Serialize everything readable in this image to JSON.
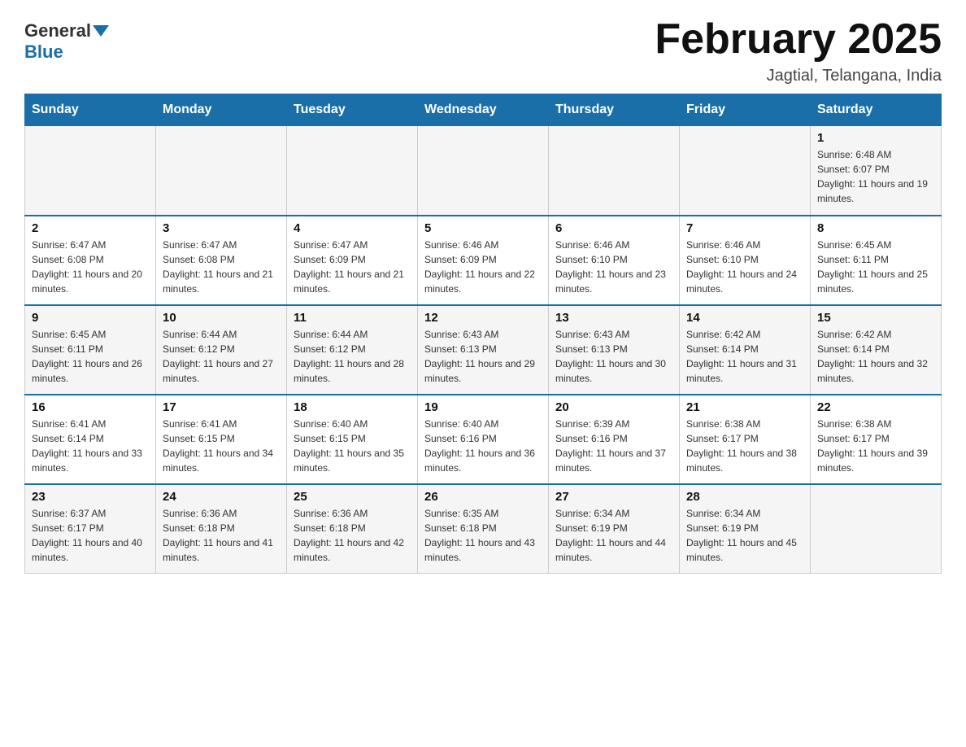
{
  "header": {
    "logo_general": "General",
    "logo_blue": "Blue",
    "title": "February 2025",
    "location": "Jagtial, Telangana, India"
  },
  "days_of_week": [
    "Sunday",
    "Monday",
    "Tuesday",
    "Wednesday",
    "Thursday",
    "Friday",
    "Saturday"
  ],
  "weeks": [
    [
      {
        "day": "",
        "info": ""
      },
      {
        "day": "",
        "info": ""
      },
      {
        "day": "",
        "info": ""
      },
      {
        "day": "",
        "info": ""
      },
      {
        "day": "",
        "info": ""
      },
      {
        "day": "",
        "info": ""
      },
      {
        "day": "1",
        "info": "Sunrise: 6:48 AM\nSunset: 6:07 PM\nDaylight: 11 hours and 19 minutes."
      }
    ],
    [
      {
        "day": "2",
        "info": "Sunrise: 6:47 AM\nSunset: 6:08 PM\nDaylight: 11 hours and 20 minutes."
      },
      {
        "day": "3",
        "info": "Sunrise: 6:47 AM\nSunset: 6:08 PM\nDaylight: 11 hours and 21 minutes."
      },
      {
        "day": "4",
        "info": "Sunrise: 6:47 AM\nSunset: 6:09 PM\nDaylight: 11 hours and 21 minutes."
      },
      {
        "day": "5",
        "info": "Sunrise: 6:46 AM\nSunset: 6:09 PM\nDaylight: 11 hours and 22 minutes."
      },
      {
        "day": "6",
        "info": "Sunrise: 6:46 AM\nSunset: 6:10 PM\nDaylight: 11 hours and 23 minutes."
      },
      {
        "day": "7",
        "info": "Sunrise: 6:46 AM\nSunset: 6:10 PM\nDaylight: 11 hours and 24 minutes."
      },
      {
        "day": "8",
        "info": "Sunrise: 6:45 AM\nSunset: 6:11 PM\nDaylight: 11 hours and 25 minutes."
      }
    ],
    [
      {
        "day": "9",
        "info": "Sunrise: 6:45 AM\nSunset: 6:11 PM\nDaylight: 11 hours and 26 minutes."
      },
      {
        "day": "10",
        "info": "Sunrise: 6:44 AM\nSunset: 6:12 PM\nDaylight: 11 hours and 27 minutes."
      },
      {
        "day": "11",
        "info": "Sunrise: 6:44 AM\nSunset: 6:12 PM\nDaylight: 11 hours and 28 minutes."
      },
      {
        "day": "12",
        "info": "Sunrise: 6:43 AM\nSunset: 6:13 PM\nDaylight: 11 hours and 29 minutes."
      },
      {
        "day": "13",
        "info": "Sunrise: 6:43 AM\nSunset: 6:13 PM\nDaylight: 11 hours and 30 minutes."
      },
      {
        "day": "14",
        "info": "Sunrise: 6:42 AM\nSunset: 6:14 PM\nDaylight: 11 hours and 31 minutes."
      },
      {
        "day": "15",
        "info": "Sunrise: 6:42 AM\nSunset: 6:14 PM\nDaylight: 11 hours and 32 minutes."
      }
    ],
    [
      {
        "day": "16",
        "info": "Sunrise: 6:41 AM\nSunset: 6:14 PM\nDaylight: 11 hours and 33 minutes."
      },
      {
        "day": "17",
        "info": "Sunrise: 6:41 AM\nSunset: 6:15 PM\nDaylight: 11 hours and 34 minutes."
      },
      {
        "day": "18",
        "info": "Sunrise: 6:40 AM\nSunset: 6:15 PM\nDaylight: 11 hours and 35 minutes."
      },
      {
        "day": "19",
        "info": "Sunrise: 6:40 AM\nSunset: 6:16 PM\nDaylight: 11 hours and 36 minutes."
      },
      {
        "day": "20",
        "info": "Sunrise: 6:39 AM\nSunset: 6:16 PM\nDaylight: 11 hours and 37 minutes."
      },
      {
        "day": "21",
        "info": "Sunrise: 6:38 AM\nSunset: 6:17 PM\nDaylight: 11 hours and 38 minutes."
      },
      {
        "day": "22",
        "info": "Sunrise: 6:38 AM\nSunset: 6:17 PM\nDaylight: 11 hours and 39 minutes."
      }
    ],
    [
      {
        "day": "23",
        "info": "Sunrise: 6:37 AM\nSunset: 6:17 PM\nDaylight: 11 hours and 40 minutes."
      },
      {
        "day": "24",
        "info": "Sunrise: 6:36 AM\nSunset: 6:18 PM\nDaylight: 11 hours and 41 minutes."
      },
      {
        "day": "25",
        "info": "Sunrise: 6:36 AM\nSunset: 6:18 PM\nDaylight: 11 hours and 42 minutes."
      },
      {
        "day": "26",
        "info": "Sunrise: 6:35 AM\nSunset: 6:18 PM\nDaylight: 11 hours and 43 minutes."
      },
      {
        "day": "27",
        "info": "Sunrise: 6:34 AM\nSunset: 6:19 PM\nDaylight: 11 hours and 44 minutes."
      },
      {
        "day": "28",
        "info": "Sunrise: 6:34 AM\nSunset: 6:19 PM\nDaylight: 11 hours and 45 minutes."
      },
      {
        "day": "",
        "info": ""
      }
    ]
  ]
}
